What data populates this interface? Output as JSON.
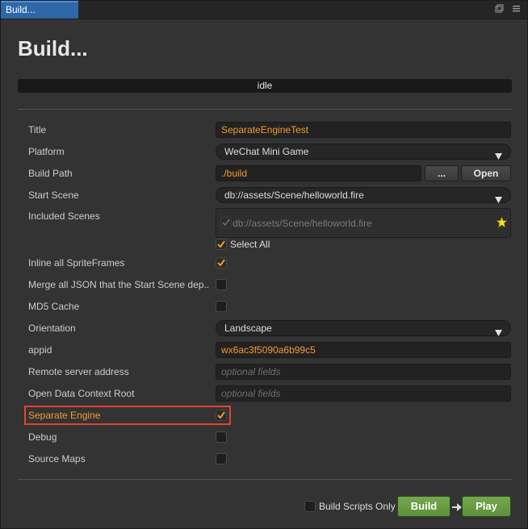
{
  "window": {
    "tab_title": "Build..."
  },
  "header": {
    "title": "Build...",
    "status": "idle"
  },
  "form": {
    "title": {
      "label": "Title",
      "value": "SeparateEngineTest"
    },
    "platform": {
      "label": "Platform",
      "value": "WeChat Mini Game"
    },
    "build_path": {
      "label": "Build Path",
      "value": "./build",
      "browse_label": "...",
      "open_label": "Open"
    },
    "start_scene": {
      "label": "Start Scene",
      "value": "db://assets/Scene/helloworld.fire"
    },
    "included_scenes": {
      "label": "Included Scenes",
      "items": [
        {
          "path": "db://assets/Scene/helloworld.fire",
          "checked": true,
          "start": true
        }
      ],
      "select_all_label": "Select All",
      "select_all_checked": true
    },
    "inline_spriteframes": {
      "label": "Inline all SpriteFrames",
      "checked": true
    },
    "merge_json": {
      "label": "Merge all JSON that the Start Scene dep...",
      "checked": false
    },
    "md5_cache": {
      "label": "MD5 Cache",
      "checked": false
    },
    "orientation": {
      "label": "Orientation",
      "value": "Landscape"
    },
    "appid": {
      "label": "appid",
      "value": "wx6ac3f5090a6b99c5"
    },
    "remote_server": {
      "label": "Remote server address",
      "value": "",
      "placeholder": "optional fields"
    },
    "open_data_context": {
      "label": "Open Data Context Root",
      "value": "",
      "placeholder": "optional fields"
    },
    "separate_engine": {
      "label": "Separate Engine",
      "checked": true
    },
    "debug": {
      "label": "Debug",
      "checked": false
    },
    "source_maps": {
      "label": "Source Maps",
      "checked": false
    }
  },
  "footer": {
    "build_scripts_only_label": "Build Scripts Only",
    "build_scripts_only_checked": false,
    "build_label": "Build",
    "play_label": "Play"
  },
  "colors": {
    "accent_orange": "#f39a2d",
    "tab_blue": "#2e68a8",
    "build_green": "#6a9c45",
    "highlight_red": "#e2442f"
  }
}
